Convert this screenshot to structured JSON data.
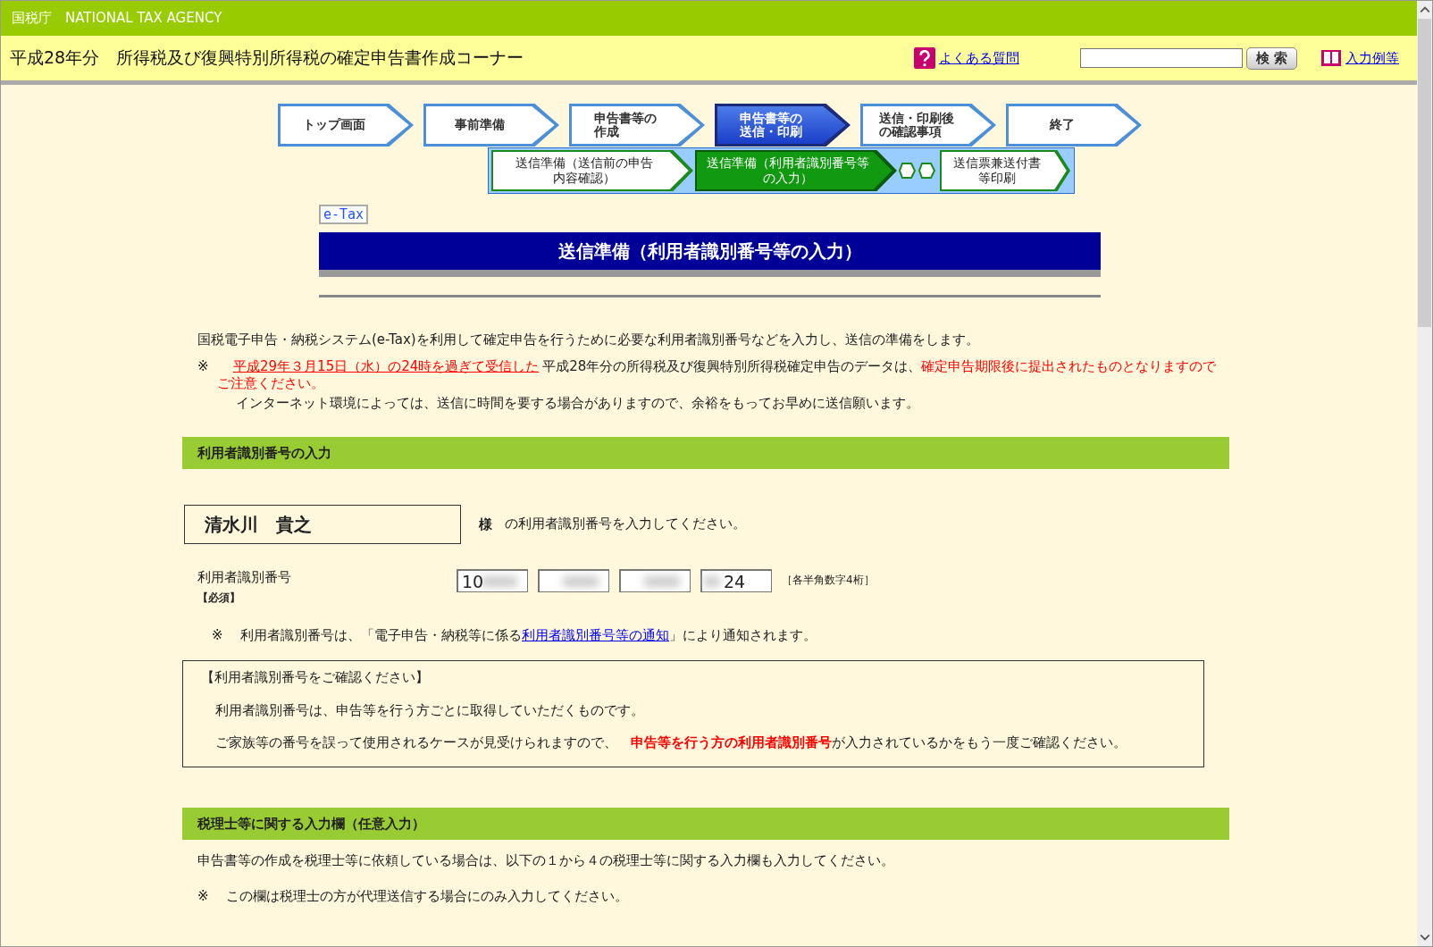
{
  "header": {
    "agency": "国税庁　NATIONAL TAX AGENCY",
    "title": "平成28年分　所得税及び復興特別所得税の確定申告書作成コーナー",
    "faq_link": "よくある質問",
    "search_button": "検 索",
    "example_link": "入力例等"
  },
  "steps": [
    {
      "lines": [
        "トップ画面"
      ],
      "selected": false
    },
    {
      "lines": [
        "事前準備"
      ],
      "selected": false
    },
    {
      "lines": [
        "申告書等の",
        "作成"
      ],
      "selected": false
    },
    {
      "lines": [
        "申告書等の",
        "送信・印刷"
      ],
      "selected": true
    },
    {
      "lines": [
        "送信・印刷後",
        "の確認事項"
      ],
      "selected": false
    },
    {
      "lines": [
        "終了"
      ],
      "selected": false
    }
  ],
  "substeps": [
    {
      "lines": [
        "送信準備（送信前の申告",
        "内容確認）"
      ],
      "selected": false
    },
    {
      "lines": [
        "送信準備（利用者識別番号等",
        "の入力）"
      ],
      "selected": true
    },
    {
      "lines": [
        "送信票兼送付書",
        "等印刷"
      ],
      "selected": false
    }
  ],
  "badge": "e-Tax",
  "page_title": "送信準備（利用者識別番号等の入力）",
  "intro": "国税電子申告・納税システム(e-Tax)を利用して確定申告を行うために必要な利用者識別番号などを入力し、送信の準備をします。",
  "notice": {
    "mark": "※",
    "segments": [
      {
        "kind": "alert-underline",
        "text": "平成29年３月15日（水）の24時を過ぎて受信した"
      },
      {
        "kind": "plain",
        "text": "平成28年分の所得税及び復興特別所得税確定申告のデータは、"
      },
      {
        "kind": "alert",
        "text": "確定申告期限後に提出されたものとなりますのでご注意ください。"
      }
    ],
    "line2": "インターネット環境によっては、送信に時間を要する場合がありますので、余裕をもってお早めに送信願います。"
  },
  "section1": {
    "heading": "利用者識別番号の入力",
    "name": "清水川　貴之",
    "honorific": "様",
    "prompt": "の利用者識別番号を入力してください。",
    "field_label": "利用者識別番号",
    "required": "【必須】",
    "inputs": [
      {
        "value": "10",
        "blurred": true
      },
      {
        "blurred": true
      },
      {
        "blurred": true
      },
      {
        "value": "24",
        "blurred": true
      }
    ],
    "hint": "［各半角数字4桁］",
    "note": {
      "mark": "※",
      "before": "利用者識別番号は、「電子申告・納税等に係る",
      "link": "利用者識別番号等の通知",
      "after": "」により通知されます。"
    },
    "confirm": {
      "title": "【利用者識別番号をご確認ください】",
      "line1": "利用者識別番号は、申告等を行う方ごとに取得していただくものです。",
      "line2": [
        {
          "kind": "plain",
          "text": "ご家族等の番号を誤って使用されるケースが見受けられますので、　"
        },
        {
          "kind": "alert-bold",
          "text": "申告等を行う方の利用者識別番号"
        },
        {
          "kind": "plain",
          "text": "が入力されているかをもう一度ご確認ください。"
        }
      ]
    }
  },
  "section2": {
    "heading": "税理士等に関する入力欄（任意入力）",
    "text1": "申告書等の作成を税理士等に依頼している場合は、以下の１から４の税理士等に関する入力欄も入力してください。",
    "mark": "※",
    "text2": "この欄は税理士の方が代理送信する場合にのみ入力してください。"
  }
}
